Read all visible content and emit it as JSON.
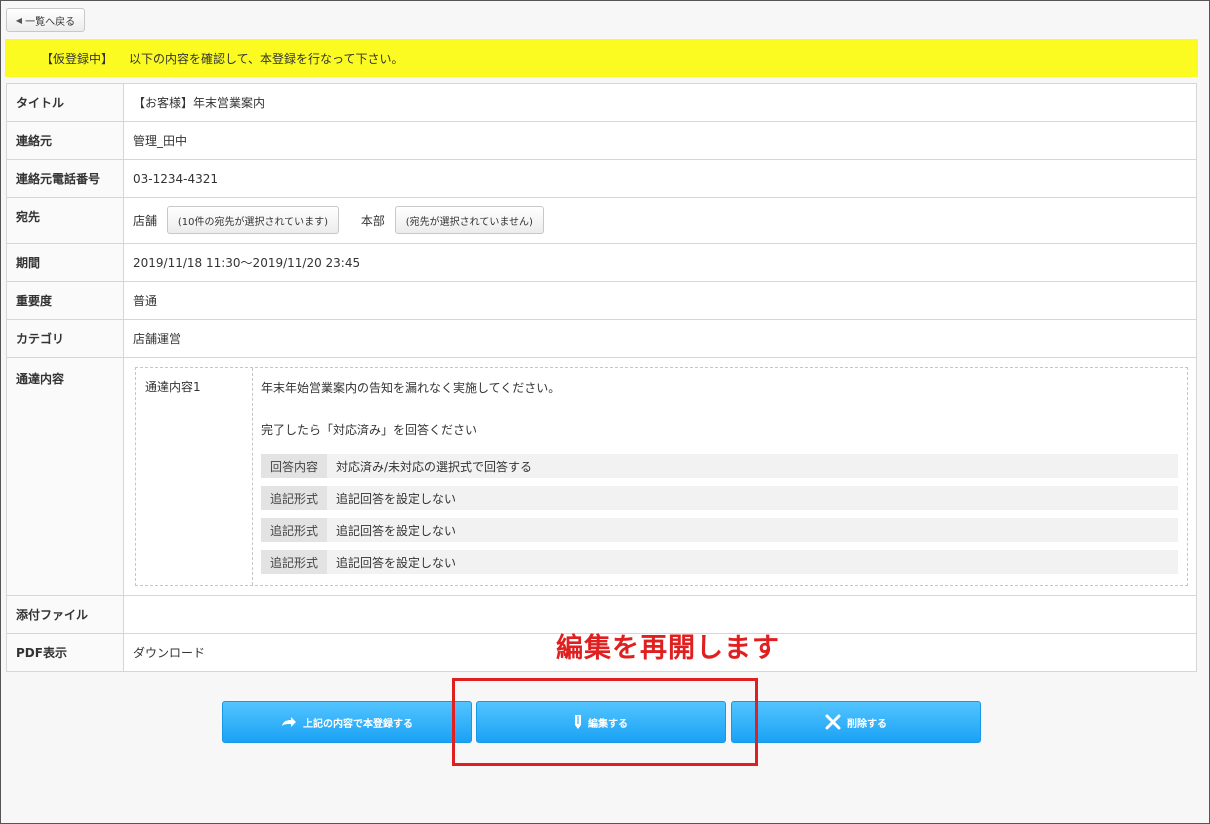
{
  "back_button": {
    "label": "一覧へ戻る",
    "icon": "triangle-left-icon"
  },
  "notice": {
    "status": "【仮登録中】",
    "message": "以下の内容を確認して、本登録を行なって下さい。",
    "background": "#fbfb22"
  },
  "fields": {
    "title": {
      "label": "タイトル",
      "value": "【お客様】年末営業案内"
    },
    "contact": {
      "label": "連絡元",
      "value": "管理_田中"
    },
    "phone": {
      "label": "連絡元電話番号",
      "value": "03-1234-4321"
    },
    "destination": {
      "label": "宛先",
      "store_label": "店舗",
      "store_button": "(10件の宛先が選択されています)",
      "hq_label": "本部",
      "hq_button": "(宛先が選択されていません)"
    },
    "period": {
      "label": "期間",
      "value": "2019/11/18 11:30〜2019/11/20 23:45"
    },
    "importance": {
      "label": "重要度",
      "value": "普通"
    },
    "category": {
      "label": "カテゴリ",
      "value": "店舗運営"
    },
    "content": {
      "label": "通達内容",
      "item_label": "通達内容1",
      "line1": "年末年始営業案内の告知を漏れなく実施してください。",
      "line2": "完了したら「対応済み」を回答ください",
      "answers": [
        {
          "key": "回答内容",
          "value": "対応済み/未対応の選択式で回答する"
        },
        {
          "key": "追記形式",
          "value": "追記回答を設定しない"
        },
        {
          "key": "追記形式",
          "value": "追記回答を設定しない"
        },
        {
          "key": "追記形式",
          "value": "追記回答を設定しない"
        }
      ]
    },
    "attachment": {
      "label": "添付ファイル",
      "value": ""
    },
    "pdf": {
      "label": "PDF表示",
      "value": "ダウンロード"
    }
  },
  "annotation": {
    "text": "編集を再開します",
    "color": "#e02020"
  },
  "actions": {
    "register": {
      "label": "上記の内容で本登録する",
      "icon": "arrow-right-icon"
    },
    "edit": {
      "label": "編集する",
      "icon": "pencil-icon"
    },
    "delete": {
      "label": "削除する",
      "icon": "close-icon"
    },
    "color": "#1aa2f5"
  }
}
